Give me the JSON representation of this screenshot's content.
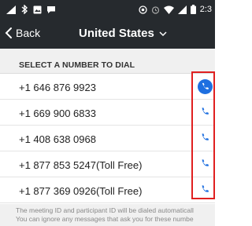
{
  "status_bar": {
    "left_icons": [
      "signal-icon",
      "bluetooth-icon",
      "image-icon",
      "chat-icon"
    ],
    "right_icons": [
      "target-icon",
      "alarm-icon",
      "wifi-icon",
      "cell-signal-icon",
      "battery-icon"
    ],
    "time": "2:3"
  },
  "app_bar": {
    "back_label": "Back",
    "title": "United States",
    "colors": {
      "background": "#262a2e",
      "text": "#ffffff"
    }
  },
  "section": {
    "label": "SELECT A NUMBER TO DIAL"
  },
  "numbers": [
    {
      "label": "+1 646 876 9923",
      "icon": "phone-icon",
      "selected": true
    },
    {
      "label": "+1 669 900 6833",
      "icon": "phone-icon",
      "selected": false
    },
    {
      "label": "+1 408 638 0968",
      "icon": "phone-icon",
      "selected": false
    },
    {
      "label": "+1 877 853 5247(Toll Free)",
      "icon": "phone-icon",
      "selected": false
    },
    {
      "label": "+1 877 369 0926(Toll Free)",
      "icon": "phone-icon",
      "selected": false
    }
  ],
  "footer": {
    "line1": "The meeting ID and participant ID will be dialed automaticall",
    "line2": "You can ignore any messages that ask you for these numbe"
  },
  "colors": {
    "accent": "#1e6fe0",
    "highlight": "#e02020"
  }
}
